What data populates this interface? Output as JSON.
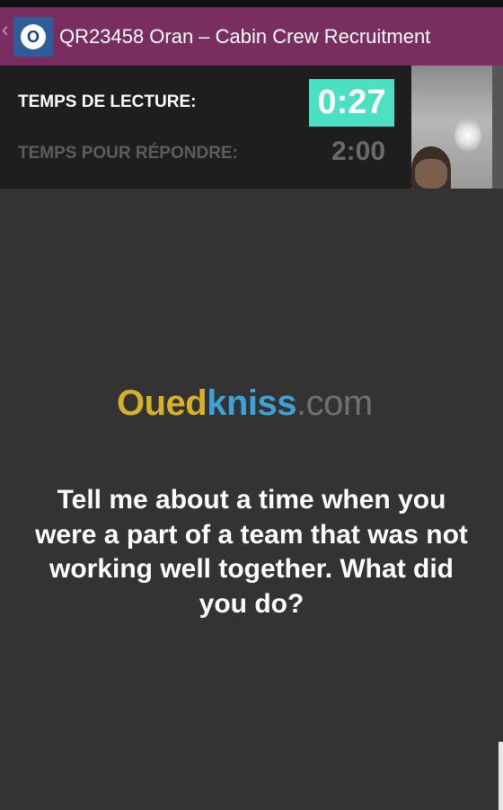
{
  "app_bar": {
    "title": "QR23458 Oran – Cabin Crew Recruitment",
    "logo_letter": "O",
    "back_icon": "chevron-left-icon"
  },
  "timers": {
    "reading_label": "TEMPS DE LECTURE:",
    "reading_value": "0:27",
    "answer_label": "TEMPS POUR RÉPONDRE:",
    "answer_value": "2:00"
  },
  "watermark": {
    "part1": "Oued",
    "part2": "kniss",
    "part3": ".com"
  },
  "question": {
    "text": "Tell me about a time when you were a part of a team that was not working well together. What did you do?"
  },
  "colors": {
    "app_bar": "#7a2e5f",
    "timer_accent": "#4ce0c3",
    "background": "#333333"
  }
}
